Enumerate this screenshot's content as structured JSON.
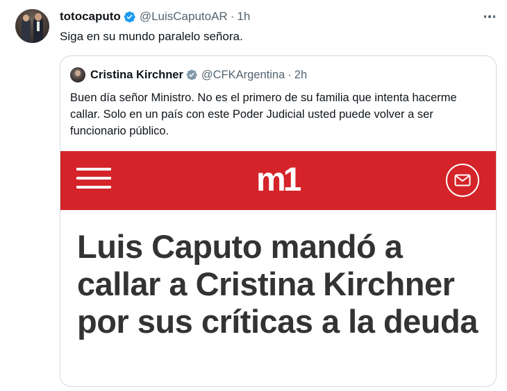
{
  "tweet": {
    "author_name": "totocaputo",
    "handle": "@LuisCaputoAR",
    "separator": "·",
    "time": "1h",
    "text": "Siga en su mundo paralelo señora.",
    "avatar_icon": "profile-photo",
    "verified_icon": "verified-badge-icon",
    "more_icon": "more-options-icon"
  },
  "quote": {
    "author_name": "Cristina Kirchner",
    "handle": "@CFKArgentina",
    "separator": "·",
    "time": "2h",
    "text": "Buen día señor Ministro. No es el primero de su familia que intenta hacerme callar. Solo en un país con este Poder Judicial usted puede volver a ser funcionario público.",
    "media": {
      "site_logo": "m1",
      "headline": "Luis Caputo mandó a callar a Cristina Kirchner por sus críticas a la deuda",
      "menu_icon": "hamburger-menu-icon",
      "mail_icon": "mail-icon"
    }
  },
  "colors": {
    "verified_blue": "#1d9bf0",
    "secondary_text": "#536471",
    "banner_red": "#d4242a",
    "headline_text": "#333333",
    "border": "#cfd9de"
  }
}
